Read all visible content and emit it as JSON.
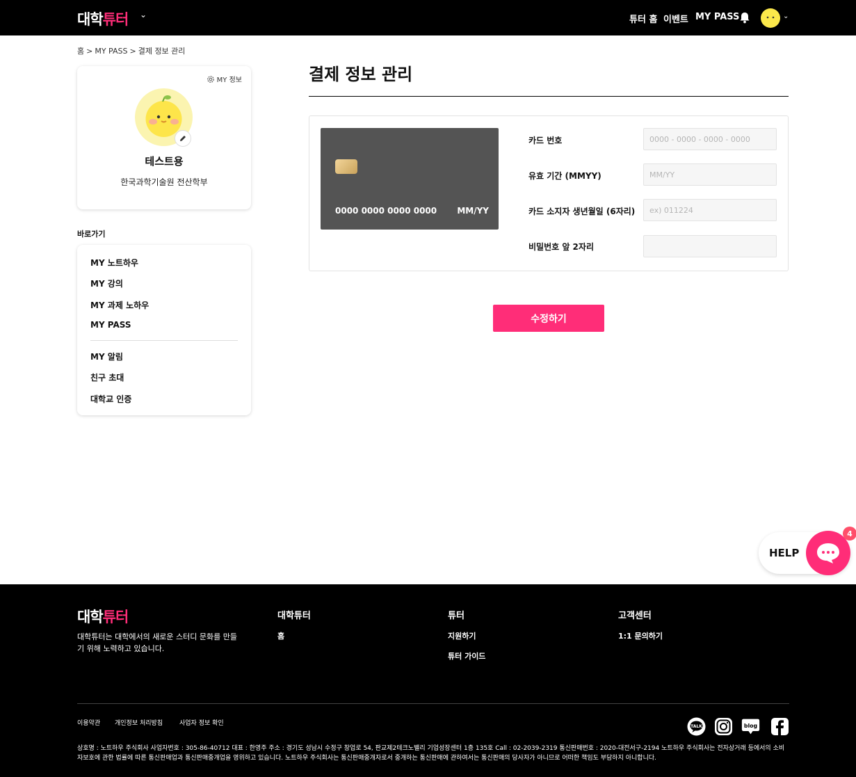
{
  "header": {
    "logo_main": "대학",
    "logo_accent": "튜터",
    "nav": [
      "튜터 홈",
      "이벤트",
      "MY PASS"
    ]
  },
  "breadcrumb": [
    "홈",
    "MY PASS",
    "결제 정보 관리"
  ],
  "profile": {
    "my_info_label": "MY 정보",
    "name": "테스트용",
    "school": "한국과학기술원 전산학부"
  },
  "shortcuts": {
    "title": "바로가기",
    "group1": [
      "MY 노트하우",
      "MY 강의",
      "MY 과제 노하우",
      "MY PASS"
    ],
    "group2": [
      "MY 알림",
      "친구 초대",
      "대학교 인증"
    ]
  },
  "main": {
    "title": "결제 정보 관리",
    "card_preview": {
      "number": "0000 0000 0000 0000",
      "expiry": "MM/YY"
    },
    "fields": [
      {
        "label": "카드 번호",
        "placeholder": "0000 - 0000 - 0000 - 0000",
        "value": ""
      },
      {
        "label": "유효 기간 (MMYY)",
        "placeholder": "MM/YY",
        "value": ""
      },
      {
        "label": "카드 소지자 생년월일 (6자리)",
        "placeholder": "ex) 011224",
        "value": ""
      },
      {
        "label": "비밀번호 앞 2자리",
        "placeholder": "",
        "value": ""
      }
    ],
    "submit_label": "수정하기"
  },
  "help": {
    "label": "HELP",
    "badge": "4"
  },
  "footer": {
    "logo_main": "대학",
    "logo_accent": "튜터",
    "description": "대학튜터는 대학에서의 새로운 스터디 문화를 만들기 위해 노력하고 있습니다.",
    "columns": [
      {
        "title": "대학튜터",
        "links": [
          "홈"
        ]
      },
      {
        "title": "튜터",
        "links": [
          "지원하기",
          "튜터 가이드"
        ]
      },
      {
        "title": "고객센터",
        "links": [
          "1:1 문의하기"
        ]
      }
    ],
    "legal_links": [
      "이용약관",
      "개인정보 처리방침",
      "사업자 정보 확인"
    ],
    "social": [
      "kakaotalk-icon",
      "instagram-icon",
      "blog-icon",
      "facebook-icon"
    ],
    "company_info": "상호명 : 노트하우 주식회사 사업자번호 : 305-86-40712 대표 : 한영주 주소 : 경기도 성남시 수정구 창업로 54, 판교제2테크노밸리 기업성장센터 1층 135호 Call : 02-2039-2319 통신판매번호 : 2020-대전서구-2194 노트하우 주식회사는 전자상거래 등에서의 소비자보호에 관한 법률에 따른 통신판매업과 통신판매중개업을 영위하고 있습니다. 노트하우 주식회사는 통신판매중개자로서 중개하는 통신판매에 관하여서는 통신판매의 당사자가 아니므로 어떠한 책임도 부담하지 아니합니다."
  },
  "colors": {
    "accent": "#ff2d78",
    "header_bg": "#000000",
    "card_bg": "#545454"
  }
}
